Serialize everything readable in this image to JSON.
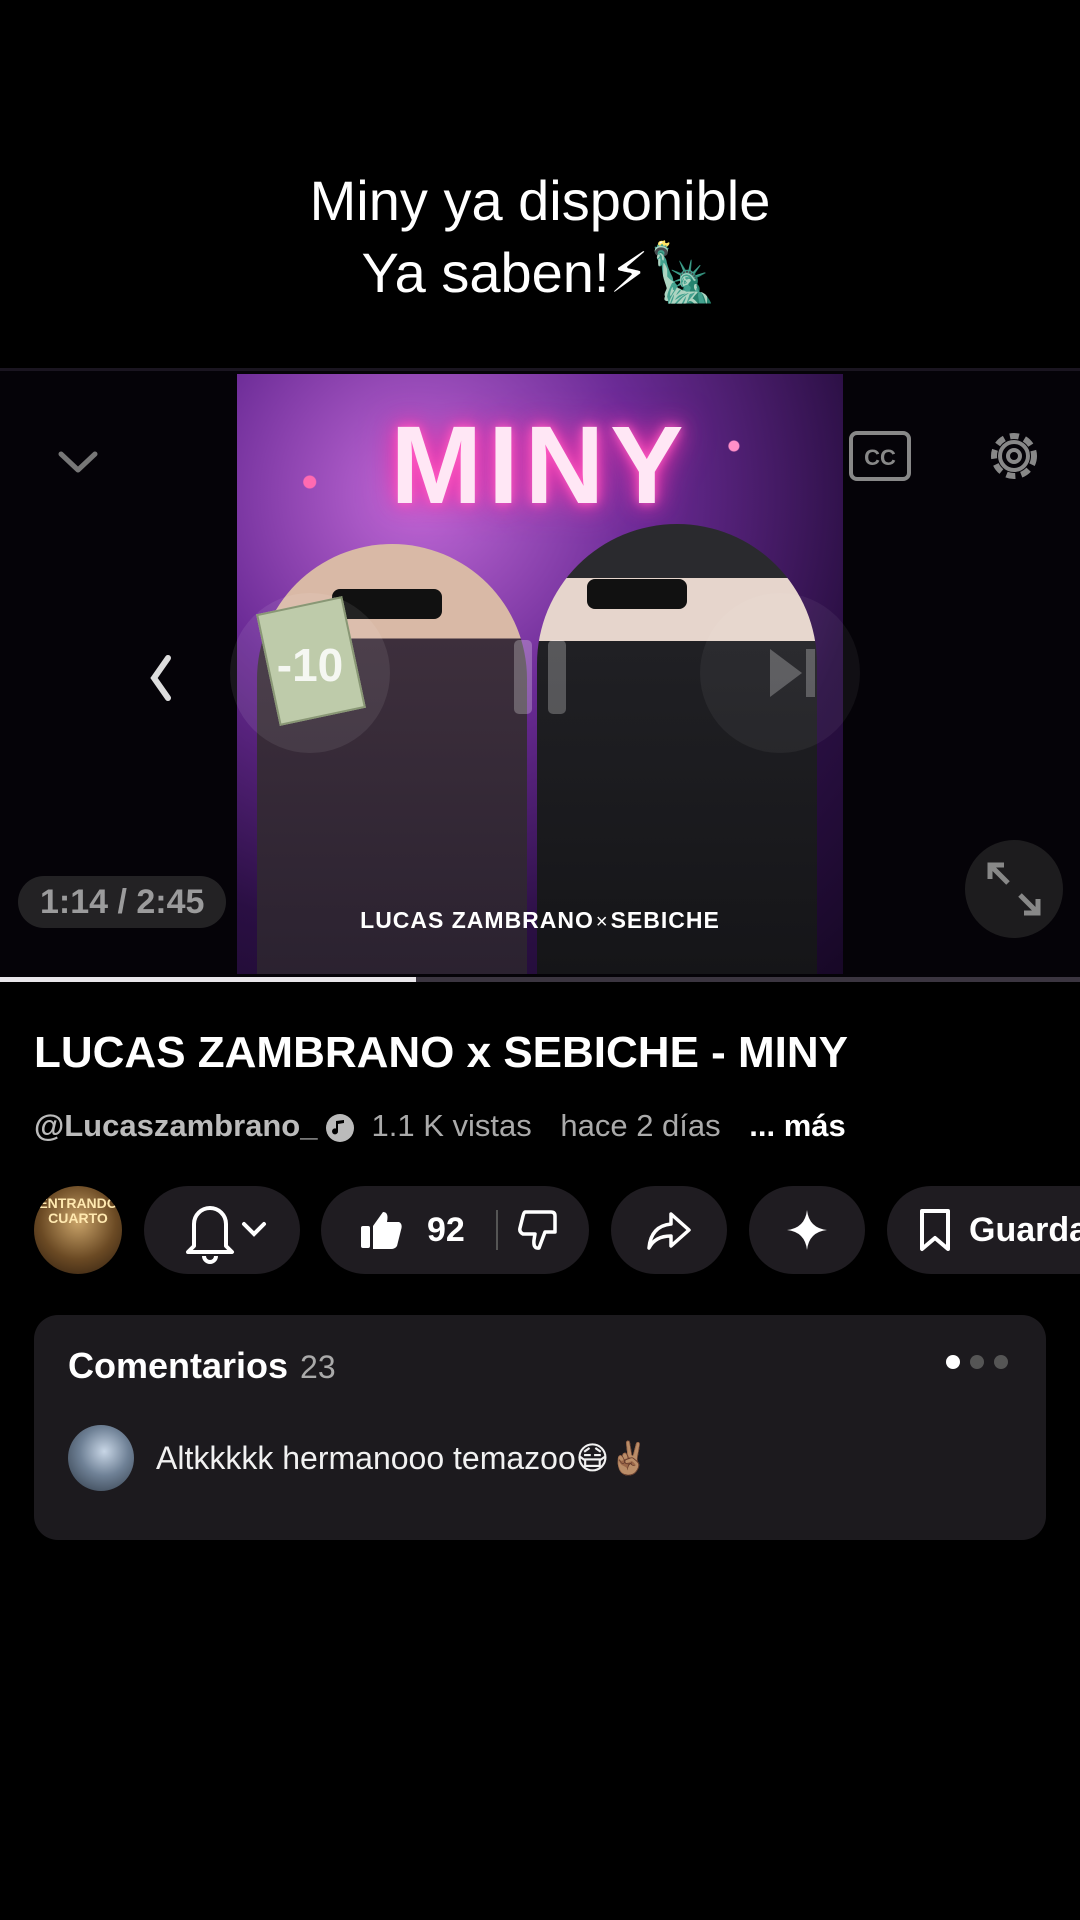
{
  "caption": {
    "line1": "Miny ya disponible",
    "line2": "Ya saben!⚡🗽"
  },
  "player": {
    "cover_title": "MINY",
    "cover_artist_left": "LUCAS ZAMBRANO",
    "cover_artist_sep": "×",
    "cover_artist_right": "SEBICHE",
    "rewind_label": "-10",
    "time": "1:14 / 2:45",
    "progress_fraction": 0.385
  },
  "video": {
    "title": "LUCAS ZAMBRANO x SEBICHE - MINY",
    "handle": "@Lucaszambrano_",
    "views": "1.1 K vistas",
    "age": "hace 2 días",
    "more": "... más"
  },
  "actions": {
    "channel_avatar_text": "ENTRANDO CUARTO",
    "likes": "92",
    "save_label": "Guardar"
  },
  "comments": {
    "title": "Comentarios",
    "count": "23",
    "top_comment": "Altkkkkk hermanooo temazoo😷✌🏽"
  },
  "colors": {
    "background": "#000000",
    "pill": "#1f1c21",
    "progress": "#e9e6ea"
  }
}
